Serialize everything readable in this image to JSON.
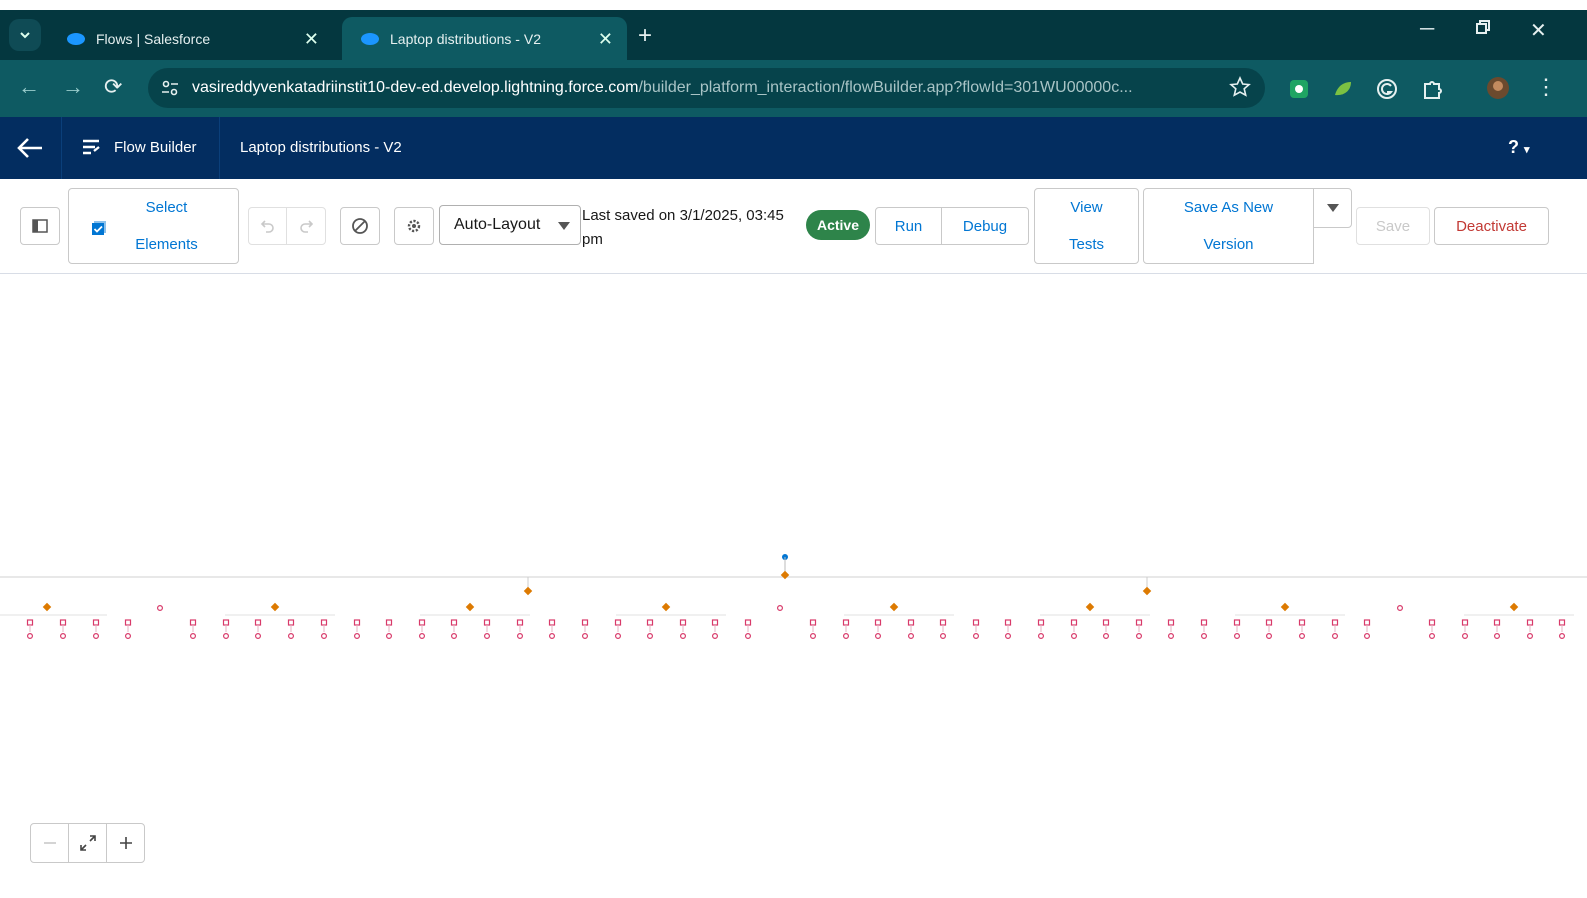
{
  "browser": {
    "tabs": [
      {
        "title": "Flows | Salesforce",
        "active": false
      },
      {
        "title": "Laptop distributions - V2",
        "active": true
      }
    ],
    "url_host": "vasireddyvenkatadriinstit10-dev-ed.develop.lightning.force.com",
    "url_path": "/builder_platform_interaction/flowBuilder.app?flowId=301WU00000c..."
  },
  "header": {
    "app_name": "Flow Builder",
    "flow_name": "Laptop distributions - V2",
    "help": "?"
  },
  "toolbar": {
    "select_elements": [
      "Select",
      "Elements"
    ],
    "layout_mode": "Auto-Layout",
    "last_saved": "Last saved on 3/1/2025, 03:45 pm",
    "status": "Active",
    "run": "Run",
    "debug": "Debug",
    "view_tests": [
      "View",
      "Tests"
    ],
    "save_as_new_version": [
      "Save As New",
      "Version"
    ],
    "save": "Save",
    "deactivate": "Deactivate"
  },
  "colors": {
    "tab_strip": "#04373f",
    "address_bar": "#0e5a62",
    "sf_header": "#032d60",
    "brand_blue": "#0176d3",
    "active_badge": "#2e844a",
    "danger": "#c23934",
    "decision_node": "#dd7a01",
    "action_node": "#d83a6a"
  }
}
